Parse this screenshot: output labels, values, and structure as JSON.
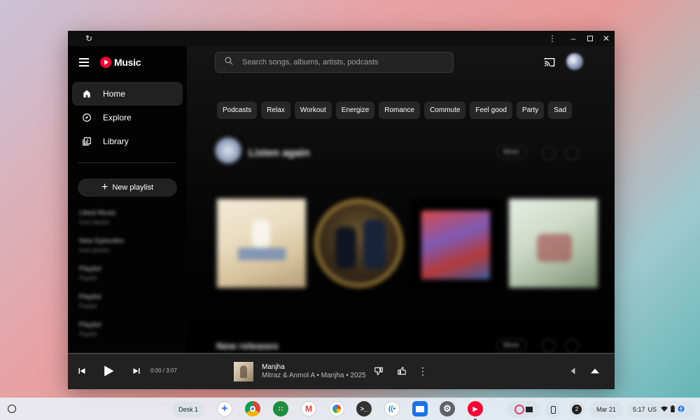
{
  "window": {
    "reload_icon": "reload-icon",
    "more_icon": "more-vert-icon",
    "minimize_icon": "minimize-icon",
    "maximize_icon": "maximize-icon",
    "close_icon": "close-icon"
  },
  "sidebar": {
    "app_name": "Music",
    "items": [
      {
        "label": "Home",
        "icon": "home-icon",
        "active": true
      },
      {
        "label": "Explore",
        "icon": "compass-icon",
        "active": false
      },
      {
        "label": "Library",
        "icon": "library-icon",
        "active": false
      }
    ],
    "new_playlist_label": "New playlist",
    "playlists": [
      {
        "title": "Liked Music",
        "sub": "Auto playlist"
      },
      {
        "title": "New Episodes",
        "sub": "Auto playlist"
      },
      {
        "title": "Playlist",
        "sub": "Playlist"
      },
      {
        "title": "Playlist",
        "sub": "Playlist"
      },
      {
        "title": "Playlist",
        "sub": "Playlist"
      }
    ]
  },
  "search": {
    "placeholder": "Search songs, albums, artists, podcasts"
  },
  "chips": [
    "Podcasts",
    "Relax",
    "Workout",
    "Energize",
    "Romance",
    "Commute",
    "Feel good",
    "Party",
    "Sad"
  ],
  "section": {
    "small": "",
    "title": "Listen again",
    "more_label": "More"
  },
  "cards": [
    {
      "title": "",
      "sub": ""
    },
    {
      "title": "",
      "sub": ""
    },
    {
      "title": "",
      "sub": ""
    },
    {
      "title": "",
      "sub": ""
    }
  ],
  "section2": {
    "title": "New releases",
    "more_label": "More"
  },
  "player": {
    "time": "0:00 / 3:07",
    "progress": 0,
    "track_title": "Manjha",
    "track_sub": "Mitraz & Anmol A • Manjha • 2025"
  },
  "shelf": {
    "desk_label": "Desk 1",
    "notification_count": "2",
    "date": "Mar 21",
    "time": "5:17",
    "locale": "US"
  },
  "colors": {
    "accent": "#ff0033",
    "chip_bg": "#272727",
    "player_bg": "#212121"
  }
}
